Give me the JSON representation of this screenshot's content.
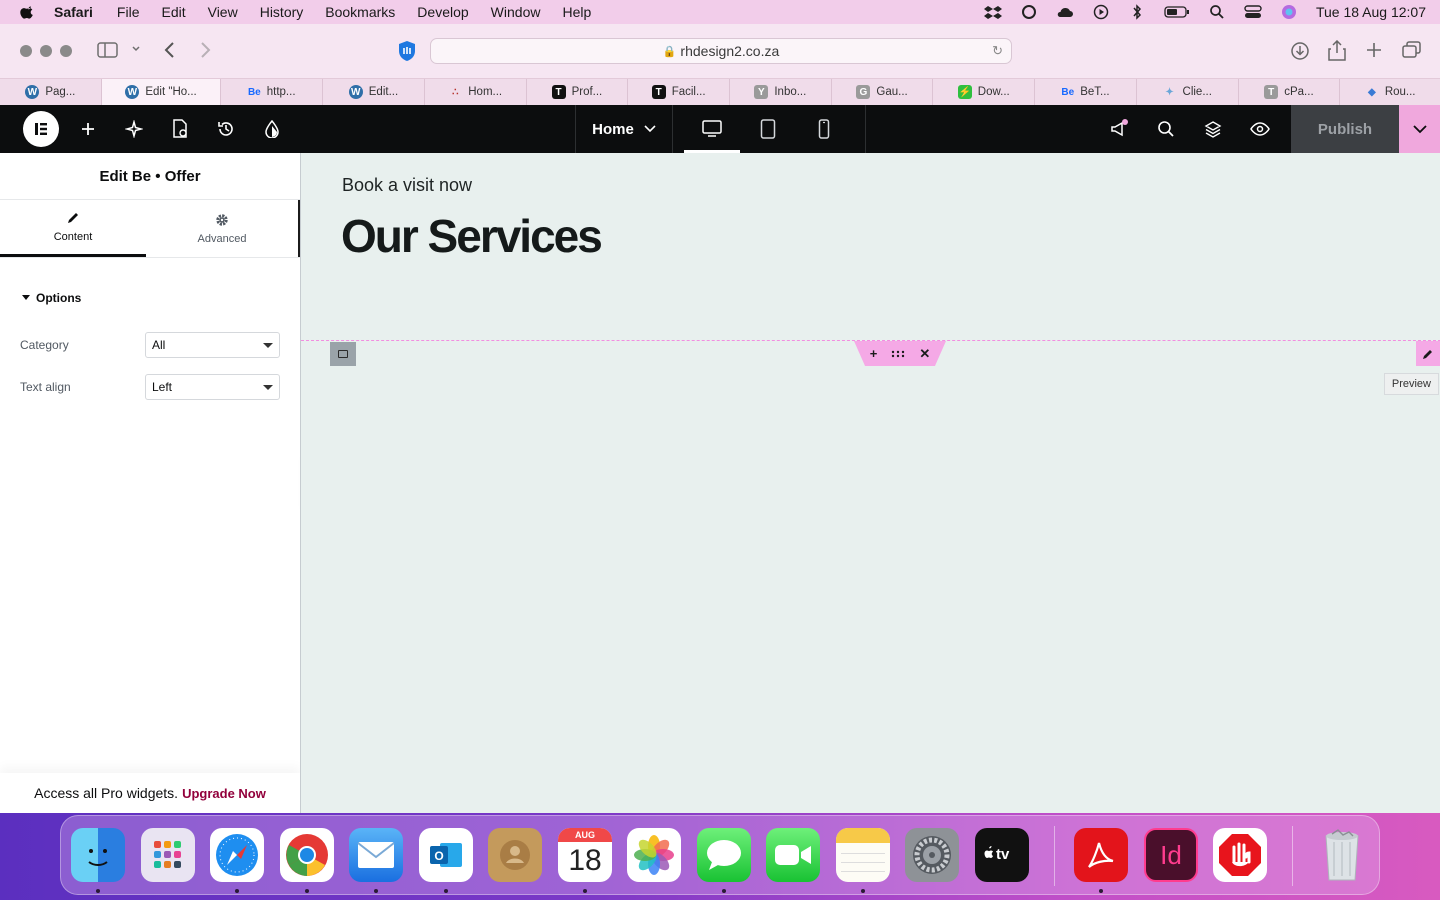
{
  "menubar": {
    "app_name": "Safari",
    "items": [
      "File",
      "Edit",
      "View",
      "History",
      "Bookmarks",
      "Develop",
      "Window",
      "Help"
    ],
    "clock": "Tue 18 Aug  12:07"
  },
  "browser": {
    "url": "rhdesign2.co.za",
    "tabs": [
      {
        "label": "Pag...",
        "icon": "wordpress-icon",
        "color": "#2f6fa8",
        "glyph": "W"
      },
      {
        "label": "Edit \"Ho...",
        "icon": "wordpress-icon",
        "color": "#2f6fa8",
        "glyph": "W"
      },
      {
        "label": "http...",
        "icon": "behance-icon",
        "color": "#1769ff",
        "glyph": "Be"
      },
      {
        "label": "Edit...",
        "icon": "wordpress-icon",
        "color": "#2f6fa8",
        "glyph": "W"
      },
      {
        "label": "Hom...",
        "icon": "site-logo-icon",
        "color": "#b5312b",
        "glyph": "∷"
      },
      {
        "label": "Prof...",
        "icon": "t-icon",
        "color": "#111111",
        "glyph": "T"
      },
      {
        "label": "Facil...",
        "icon": "t-icon",
        "color": "#111111",
        "glyph": "T"
      },
      {
        "label": "Inbo...",
        "icon": "y-icon",
        "color": "#9a9a9a",
        "glyph": "Y"
      },
      {
        "label": "Gau...",
        "icon": "g-icon",
        "color": "#9a9a9a",
        "glyph": "G"
      },
      {
        "label": "Dow...",
        "icon": "download-app-icon",
        "color": "#2fbf3f",
        "glyph": "⚡"
      },
      {
        "label": "BeT...",
        "icon": "behance-icon",
        "color": "#1769ff",
        "glyph": "Be"
      },
      {
        "label": "Clie...",
        "icon": "client-icon",
        "color": "#6aa6d8",
        "glyph": "✦"
      },
      {
        "label": "cPa...",
        "icon": "t-icon",
        "color": "#9a9a9a",
        "glyph": "T"
      },
      {
        "label": "Rou...",
        "icon": "route-icon",
        "color": "#3a7bd5",
        "glyph": "◆"
      }
    ]
  },
  "editor": {
    "page_menu": "Home",
    "publish_label": "Publish"
  },
  "panel": {
    "title": "Edit Be • Offer",
    "tabs": {
      "content": "Content",
      "advanced": "Advanced"
    },
    "section": "Options",
    "fields": [
      {
        "label": "Category",
        "value": "All"
      },
      {
        "label": "Text align",
        "value": "Left"
      }
    ],
    "promo_text": "Access all Pro widgets.",
    "promo_link": "Upgrade Now"
  },
  "canvas": {
    "kicker": "Book a visit now",
    "headline": "Our Services",
    "tooltip": "Preview"
  },
  "dock": {
    "calendar_month": "AUG",
    "calendar_day": "18",
    "apps": [
      "Finder",
      "Launchpad",
      "Safari",
      "Chrome",
      "Mail",
      "Outlook",
      "Contacts",
      "Calendar",
      "Photos",
      "Messages",
      "FaceTime",
      "Notes",
      "System Preferences",
      "Apple TV",
      "Acrobat",
      "InDesign",
      "AdBlock",
      "Trash"
    ]
  }
}
